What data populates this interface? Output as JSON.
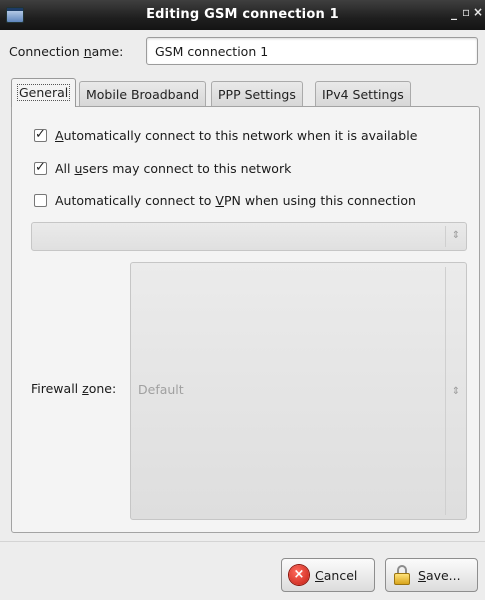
{
  "window": {
    "title": "Editing GSM connection 1",
    "minimize_glyph": "_",
    "maximize_glyph": "▫",
    "close_glyph": "×"
  },
  "connection_name": {
    "label_pre": "Connection ",
    "label_mnemonic": "n",
    "label_post": "ame:",
    "value": "GSM connection 1"
  },
  "tabs": [
    {
      "label": "General",
      "active": true
    },
    {
      "label": "Mobile Broadband",
      "active": false
    },
    {
      "label": "PPP Settings",
      "active": false
    },
    {
      "label": "IPv4 Settings",
      "active": false
    }
  ],
  "general": {
    "auto_connect": {
      "checked": true,
      "label_mnemonic": "A",
      "label_post": "utomatically connect to this network when it is available"
    },
    "all_users": {
      "checked": true,
      "label_pre": "All ",
      "label_mnemonic": "u",
      "label_post": "sers may connect to this network"
    },
    "auto_vpn": {
      "checked": false,
      "label_pre": "Automatically connect to ",
      "label_mnemonic": "V",
      "label_post": "PN when using this connection"
    },
    "vpn_select": {
      "value": ""
    },
    "firewall_zone": {
      "label_pre": "Firewall ",
      "label_mnemonic": "z",
      "label_post": "one:",
      "value": "Default"
    }
  },
  "buttons": {
    "cancel": {
      "mnemonic": "C",
      "label_post": "ancel",
      "icon": "cancel-icon"
    },
    "save": {
      "mnemonic": "S",
      "label_post": "ave...",
      "icon": "lock-icon"
    }
  }
}
